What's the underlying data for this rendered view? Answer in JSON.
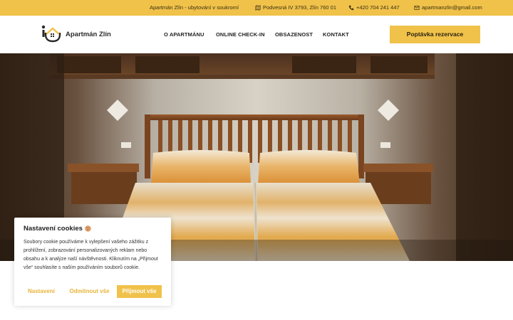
{
  "topbar": {
    "tagline": "Apartmán Zlín - ubytování v soukromí",
    "address": "Podvesná IV 3793, Zlín 760 01",
    "phone": "+420 704 241 447",
    "email": "apartmanzlin@gmail.com",
    "icons": {
      "address": "map-icon",
      "phone": "phone-icon",
      "email": "mail-icon"
    }
  },
  "header": {
    "logo_text": "Apartmán Zlín",
    "nav": [
      "O APARTMÁNU",
      "ONLINE CHECK-IN",
      "OBSAZENOST",
      "KONTAKT"
    ],
    "cta_label": "Poptávka rezervace"
  },
  "cookie": {
    "title": "Nastavení cookies",
    "text": "Soubory cookie používáme k vylepšení vašeho zážitku z prohlížení, zobrazování personalizovaných reklam nebo obsahu a k analýze naší návštěvnosti. Kliknutím na „Přijmout vše“ souhlasíte s naším používáním souborů cookie.",
    "buttons": {
      "settings": "Nastavení",
      "reject": "Odmítnout vše",
      "accept": "Přijmout vše"
    }
  },
  "colors": {
    "accent": "#f0c24a",
    "accent_text": "#e7b43a"
  }
}
